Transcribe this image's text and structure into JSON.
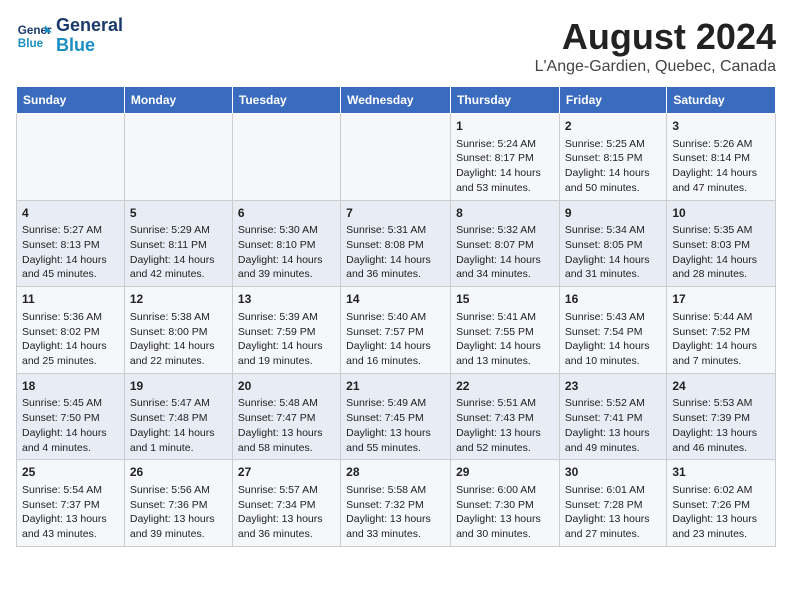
{
  "header": {
    "logo_line1": "General",
    "logo_line2": "Blue",
    "title": "August 2024",
    "subtitle": "L'Ange-Gardien, Quebec, Canada"
  },
  "days_of_week": [
    "Sunday",
    "Monday",
    "Tuesday",
    "Wednesday",
    "Thursday",
    "Friday",
    "Saturday"
  ],
  "weeks": [
    [
      {
        "day": "",
        "content": ""
      },
      {
        "day": "",
        "content": ""
      },
      {
        "day": "",
        "content": ""
      },
      {
        "day": "",
        "content": ""
      },
      {
        "day": "1",
        "content": "Sunrise: 5:24 AM\nSunset: 8:17 PM\nDaylight: 14 hours\nand 53 minutes."
      },
      {
        "day": "2",
        "content": "Sunrise: 5:25 AM\nSunset: 8:15 PM\nDaylight: 14 hours\nand 50 minutes."
      },
      {
        "day": "3",
        "content": "Sunrise: 5:26 AM\nSunset: 8:14 PM\nDaylight: 14 hours\nand 47 minutes."
      }
    ],
    [
      {
        "day": "4",
        "content": "Sunrise: 5:27 AM\nSunset: 8:13 PM\nDaylight: 14 hours\nand 45 minutes."
      },
      {
        "day": "5",
        "content": "Sunrise: 5:29 AM\nSunset: 8:11 PM\nDaylight: 14 hours\nand 42 minutes."
      },
      {
        "day": "6",
        "content": "Sunrise: 5:30 AM\nSunset: 8:10 PM\nDaylight: 14 hours\nand 39 minutes."
      },
      {
        "day": "7",
        "content": "Sunrise: 5:31 AM\nSunset: 8:08 PM\nDaylight: 14 hours\nand 36 minutes."
      },
      {
        "day": "8",
        "content": "Sunrise: 5:32 AM\nSunset: 8:07 PM\nDaylight: 14 hours\nand 34 minutes."
      },
      {
        "day": "9",
        "content": "Sunrise: 5:34 AM\nSunset: 8:05 PM\nDaylight: 14 hours\nand 31 minutes."
      },
      {
        "day": "10",
        "content": "Sunrise: 5:35 AM\nSunset: 8:03 PM\nDaylight: 14 hours\nand 28 minutes."
      }
    ],
    [
      {
        "day": "11",
        "content": "Sunrise: 5:36 AM\nSunset: 8:02 PM\nDaylight: 14 hours\nand 25 minutes."
      },
      {
        "day": "12",
        "content": "Sunrise: 5:38 AM\nSunset: 8:00 PM\nDaylight: 14 hours\nand 22 minutes."
      },
      {
        "day": "13",
        "content": "Sunrise: 5:39 AM\nSunset: 7:59 PM\nDaylight: 14 hours\nand 19 minutes."
      },
      {
        "day": "14",
        "content": "Sunrise: 5:40 AM\nSunset: 7:57 PM\nDaylight: 14 hours\nand 16 minutes."
      },
      {
        "day": "15",
        "content": "Sunrise: 5:41 AM\nSunset: 7:55 PM\nDaylight: 14 hours\nand 13 minutes."
      },
      {
        "day": "16",
        "content": "Sunrise: 5:43 AM\nSunset: 7:54 PM\nDaylight: 14 hours\nand 10 minutes."
      },
      {
        "day": "17",
        "content": "Sunrise: 5:44 AM\nSunset: 7:52 PM\nDaylight: 14 hours\nand 7 minutes."
      }
    ],
    [
      {
        "day": "18",
        "content": "Sunrise: 5:45 AM\nSunset: 7:50 PM\nDaylight: 14 hours\nand 4 minutes."
      },
      {
        "day": "19",
        "content": "Sunrise: 5:47 AM\nSunset: 7:48 PM\nDaylight: 14 hours\nand 1 minute."
      },
      {
        "day": "20",
        "content": "Sunrise: 5:48 AM\nSunset: 7:47 PM\nDaylight: 13 hours\nand 58 minutes."
      },
      {
        "day": "21",
        "content": "Sunrise: 5:49 AM\nSunset: 7:45 PM\nDaylight: 13 hours\nand 55 minutes."
      },
      {
        "day": "22",
        "content": "Sunrise: 5:51 AM\nSunset: 7:43 PM\nDaylight: 13 hours\nand 52 minutes."
      },
      {
        "day": "23",
        "content": "Sunrise: 5:52 AM\nSunset: 7:41 PM\nDaylight: 13 hours\nand 49 minutes."
      },
      {
        "day": "24",
        "content": "Sunrise: 5:53 AM\nSunset: 7:39 PM\nDaylight: 13 hours\nand 46 minutes."
      }
    ],
    [
      {
        "day": "25",
        "content": "Sunrise: 5:54 AM\nSunset: 7:37 PM\nDaylight: 13 hours\nand 43 minutes."
      },
      {
        "day": "26",
        "content": "Sunrise: 5:56 AM\nSunset: 7:36 PM\nDaylight: 13 hours\nand 39 minutes."
      },
      {
        "day": "27",
        "content": "Sunrise: 5:57 AM\nSunset: 7:34 PM\nDaylight: 13 hours\nand 36 minutes."
      },
      {
        "day": "28",
        "content": "Sunrise: 5:58 AM\nSunset: 7:32 PM\nDaylight: 13 hours\nand 33 minutes."
      },
      {
        "day": "29",
        "content": "Sunrise: 6:00 AM\nSunset: 7:30 PM\nDaylight: 13 hours\nand 30 minutes."
      },
      {
        "day": "30",
        "content": "Sunrise: 6:01 AM\nSunset: 7:28 PM\nDaylight: 13 hours\nand 27 minutes."
      },
      {
        "day": "31",
        "content": "Sunrise: 6:02 AM\nSunset: 7:26 PM\nDaylight: 13 hours\nand 23 minutes."
      }
    ]
  ]
}
